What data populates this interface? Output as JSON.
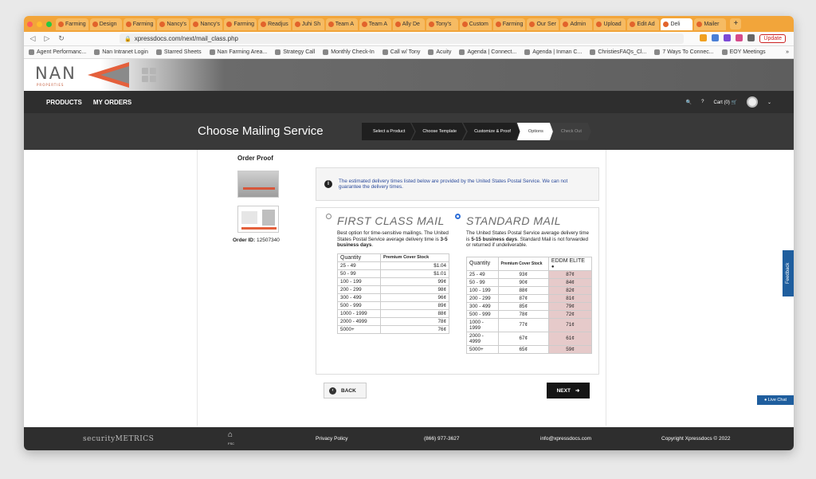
{
  "browser": {
    "tabs": [
      "Farming",
      "Design",
      "Farming",
      "Nancy's",
      "Nancy's",
      "Farming",
      "Readjus",
      "Juhi Sh",
      "Team A",
      "Team A",
      "Ally De",
      "Tony's",
      "Custom",
      "Farming",
      "Our Ser",
      "Admin",
      "Upload",
      "Edit Ad",
      "Deli",
      "Mailer"
    ],
    "new_tab": "+",
    "url": "xpressdocs.com/next/mail_class.php",
    "update_label": "Update",
    "bookmarks": [
      "Agent Performanc...",
      "Nan Intranet Login",
      "Starred Sheets",
      "Nan Farming Area...",
      "Strategy Call",
      "Monthly Check-In",
      "Call w/ Tony",
      "Acuity",
      "Agenda | Connect...",
      "Agenda | Inman C...",
      "ChristiesFAQs_Cl...",
      "7 Ways To Connec...",
      "EOY Meetings"
    ],
    "bookmarks_more": "»"
  },
  "site": {
    "logo": "NAN",
    "logo_sub": "PROPERTIES",
    "nav": {
      "products": "PRODUCTS",
      "orders": "MY ORDERS",
      "cart": "Cart (0)"
    },
    "page_title": "Choose Mailing Service",
    "steps": [
      "Select a Product",
      "Choose Template",
      "Customize & Proof",
      "Options",
      "Check Out"
    ]
  },
  "proof": {
    "title": "Order Proof",
    "order_label": "Order ID:",
    "order_id": "12507340"
  },
  "info_text": "The estimated delivery times listed below are provided by the United States Postal Service. We can not guarantee the delivery times.",
  "first_class": {
    "title": "FIRST CLASS MAIL",
    "desc": "Best option for time-sensitive mailings. The United States Postal Service average delivery time is",
    "desc_bold": "3-5 business days",
    "headers": [
      "Quantity",
      "Premium Cover Stock"
    ],
    "rows": [
      [
        "25 - 49",
        "$1.04"
      ],
      [
        "50 - 99",
        "$1.01"
      ],
      [
        "100 - 199",
        "99¢"
      ],
      [
        "200 - 299",
        "98¢"
      ],
      [
        "300 - 499",
        "96¢"
      ],
      [
        "500 - 999",
        "89¢"
      ],
      [
        "1000 - 1999",
        "88¢"
      ],
      [
        "2000 - 4999",
        "78¢"
      ],
      [
        "5000+",
        "76¢"
      ]
    ]
  },
  "standard": {
    "title": "STANDARD MAIL",
    "desc": "The United States Postal Service average delivery time is",
    "desc_bold": "5-15 business days",
    "desc_end": ". Standard Mail is not forwarded or returned if undeliverable.",
    "headers": [
      "Quantity",
      "Premium Cover Stock",
      "EDDM ELITE"
    ],
    "rows": [
      [
        "25 - 49",
        "93¢",
        "87¢"
      ],
      [
        "50 - 99",
        "90¢",
        "84¢"
      ],
      [
        "100 - 199",
        "88¢",
        "82¢"
      ],
      [
        "200 - 299",
        "87¢",
        "81¢"
      ],
      [
        "300 - 499",
        "85¢",
        "79¢"
      ],
      [
        "500 - 999",
        "78¢",
        "72¢"
      ],
      [
        "1000 - 1999",
        "77¢",
        "71¢"
      ],
      [
        "2000 - 4999",
        "67¢",
        "61¢"
      ],
      [
        "5000+",
        "65¢",
        "59¢"
      ]
    ]
  },
  "buttons": {
    "back": "BACK",
    "next": "NEXT"
  },
  "widgets": {
    "feedback": "Feedback",
    "live_chat": "Live Chat"
  },
  "footer": {
    "security": "securityMETRICS",
    "fsc": "FSC",
    "privacy": "Privacy Policy",
    "phone": "(866) 977-3627",
    "email": "info@xpressdocs.com",
    "copyright": "Copyright Xpressdocs © 2022"
  },
  "colors": {
    "accent": "#e4603c",
    "tab_bar": "#f2a53a",
    "eddm": "#e6caca",
    "radio": "#2e6fd8"
  }
}
